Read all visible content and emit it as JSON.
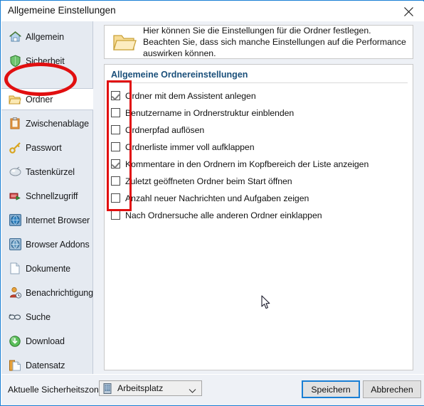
{
  "window": {
    "title": "Allgemeine Einstellungen",
    "close_icon": "close-icon",
    "border_color": "#1a7fd4"
  },
  "sidebar": {
    "items": [
      {
        "label": "Allgemein",
        "icon": "home-icon",
        "selected": false
      },
      {
        "label": "Sicherheit",
        "icon": "shield-icon",
        "selected": false
      },
      {
        "label": "Ordner",
        "icon": "folder-icon",
        "selected": true
      },
      {
        "label": "Zwischenablage",
        "icon": "clipboard-icon",
        "selected": false
      },
      {
        "label": "Passwort",
        "icon": "key-icon",
        "selected": false
      },
      {
        "label": "Tastenkürzel",
        "icon": "keyboard-icon",
        "selected": false
      },
      {
        "label": "Schnellzugriff",
        "icon": "quick-access-icon",
        "selected": false
      },
      {
        "label": "Internet Browser",
        "icon": "browser-icon",
        "selected": false
      },
      {
        "label": "Browser Addons",
        "icon": "addons-icon",
        "selected": false
      },
      {
        "label": "Dokumente",
        "icon": "document-icon",
        "selected": false
      },
      {
        "label": "Benachrichtigung",
        "icon": "notification-icon",
        "selected": false
      },
      {
        "label": "Suche",
        "icon": "search-glasses-icon",
        "selected": false
      },
      {
        "label": "Download",
        "icon": "download-icon",
        "selected": false
      },
      {
        "label": "Datensatz",
        "icon": "record-icon",
        "selected": false
      }
    ]
  },
  "main": {
    "info": {
      "icon": "folder-icon",
      "text": "Hier können Sie die Einstellungen für die Ordner festlegen. Beachten Sie, dass sich manche Einstellungen auf die Performance auswirken können."
    },
    "group_title": "Allgemeine Ordnereinstellungen",
    "checkboxes": [
      {
        "label": "Ordner mit dem Assistent anlegen",
        "checked": true
      },
      {
        "label": "Benutzername in Ordnerstruktur einblenden",
        "checked": false
      },
      {
        "label": "Ordnerpfad auflösen",
        "checked": false
      },
      {
        "label": "Ordnerliste immer voll aufklappen",
        "checked": false
      },
      {
        "label": "Kommentare in den Ordnern im Kopfbereich der Liste anzeigen",
        "checked": true
      },
      {
        "label": "Zuletzt geöffneten Ordner beim Start öffnen",
        "checked": false
      },
      {
        "label": "Anzahl neuer Nachrichten und Aufgaben zeigen",
        "checked": false
      },
      {
        "label": "Nach Ordnersuche alle anderen Ordner einklappen",
        "checked": false
      }
    ]
  },
  "footer": {
    "zone_label": "Aktuelle Sicherheitszone",
    "zone_value": "Arbeitsplatz",
    "zone_icon": "computer-icon",
    "zone_chevron_icon": "chevron-down-icon",
    "save_label": "Speichern",
    "cancel_label": "Abbrechen"
  },
  "annotations": {
    "color": "#e10f10",
    "ellipse_target": "Ordner",
    "rect_target": "checkbox-column"
  }
}
